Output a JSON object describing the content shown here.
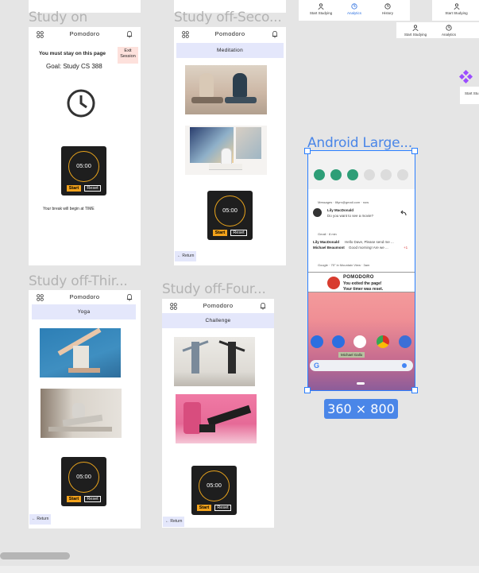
{
  "colors": {
    "canvas": "#e5e5e5",
    "frame_title": "#b3b3b3",
    "band": "#e4e7fb",
    "timer_bg": "#1e1e1e",
    "accent": "#f2a21b",
    "selection": "#2b7fff"
  },
  "app": {
    "name": "Pomodoro",
    "start_label": "Start",
    "reset_label": "Reset",
    "timer_value": "05:00",
    "return_label": "← Return"
  },
  "frames": {
    "study_on": {
      "title": "Study on",
      "stay_text": "You must stay on this page",
      "exit_label": "Exit Session",
      "goal_text": "Goal:  Study CS 388",
      "break_text": "Your break will begin at TIME"
    },
    "study_off_second": {
      "title": "Study off-Seco...",
      "section": "Meditation"
    },
    "study_off_third": {
      "title": "Study off-Thir...",
      "section": "Yoga"
    },
    "study_off_fourth": {
      "title": "Study off-Four...",
      "section": "Challenge"
    },
    "android": {
      "title": "Android Large...",
      "size_badge": "360 × 800",
      "notifications": [
        {
          "app": "Messages · lillyrn@gmail.com · now",
          "sender": "Lily MacDonald",
          "text": "Do you want to see a movie?"
        },
        {
          "app": "Gmail · 8 min",
          "sender": "Lily MacDonald",
          "text": "Hello Dave, Please send me ...",
          "sender2": "Michael Beaumont",
          "text2": "Good morning! Are we ...",
          "extra": "+1"
        },
        {
          "app": "Google · 75° in Mountain View · 3am"
        }
      ],
      "pomodoro_title": "POMODORO",
      "pomodoro_line1": "You exited the page!",
      "pomodoro_line2": "Your timer was reset.",
      "tooltip": "Michael Gallo"
    }
  },
  "top_nav": {
    "items": [
      {
        "label": "Start Studying",
        "icon": "person-icon"
      },
      {
        "label": "Analytics",
        "icon": "clock-icon"
      },
      {
        "label": "History",
        "icon": "history-icon"
      }
    ],
    "right_item": "Start Studying",
    "second_row": [
      {
        "label": "Start Studying"
      },
      {
        "label": "Analytics"
      }
    ],
    "edge_label": "Start Stu"
  }
}
